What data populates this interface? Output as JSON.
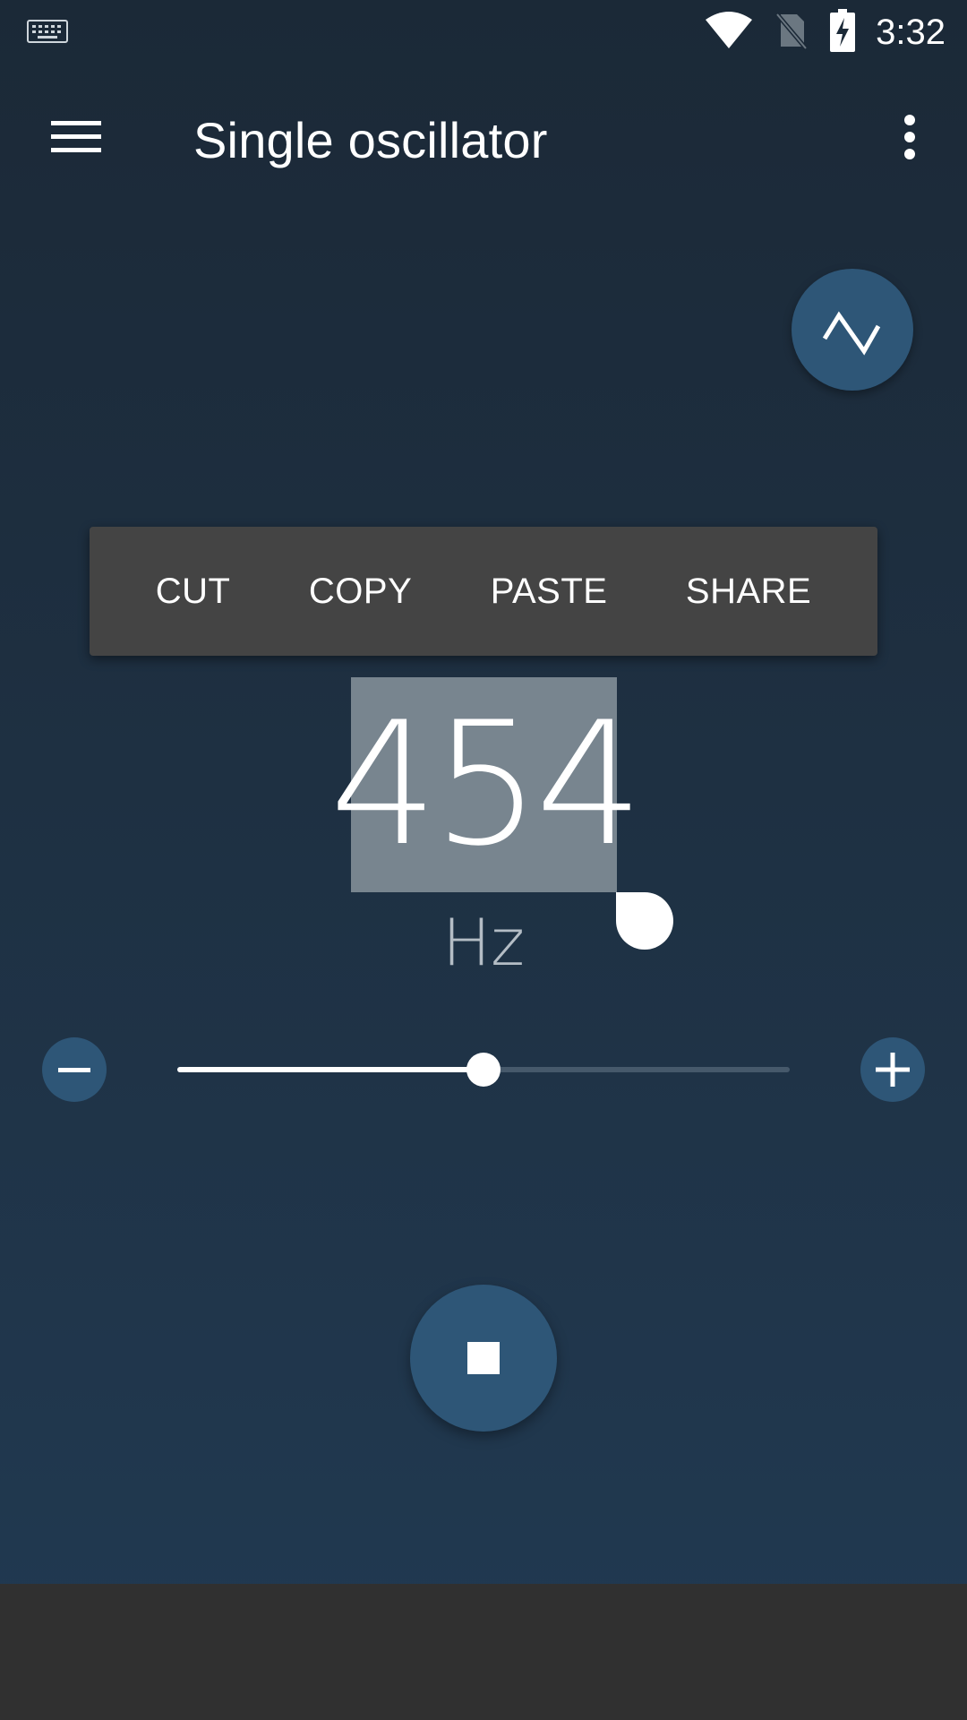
{
  "status_bar": {
    "time": "3:32",
    "icons": [
      "keyboard-icon",
      "wifi-icon",
      "no-sim-icon",
      "battery-charging-icon"
    ]
  },
  "app_bar": {
    "title": "Single oscillator",
    "menu_icon": "hamburger-menu-icon",
    "overflow_icon": "more-vert-icon"
  },
  "waveform": {
    "icon": "triangle-wave-icon"
  },
  "context_menu": {
    "items": [
      "CUT",
      "COPY",
      "PASTE",
      "SHARE"
    ]
  },
  "frequency": {
    "value": "454",
    "unit": "Hz",
    "selected": true
  },
  "slider": {
    "level": 0.5,
    "decrease_icon": "minus-icon",
    "increase_icon": "plus-icon"
  },
  "playback": {
    "state": "playing",
    "icon": "stop-icon"
  },
  "colors": {
    "accent": "#2e5677",
    "background_top": "#1b2937",
    "background_bottom": "#213a52",
    "menu_bg": "#444444",
    "selection": "#78858f",
    "bottom_panel": "#303030"
  }
}
